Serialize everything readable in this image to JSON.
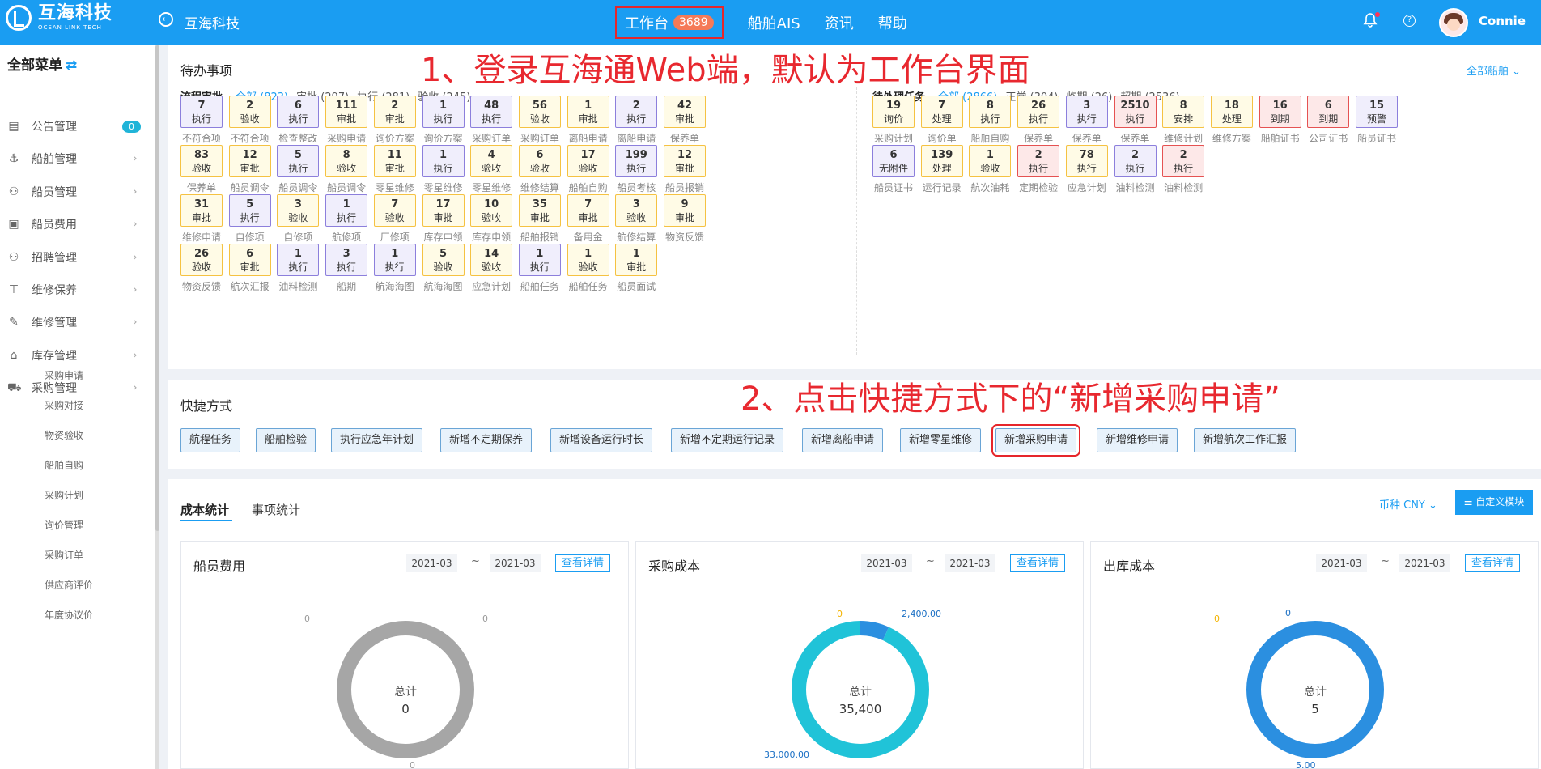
{
  "header": {
    "logo_cn": "互海科技",
    "logo_en": "OCEAN LINK TECH",
    "company": "互海科技",
    "workbench": "工作台",
    "workbench_badge": "3689",
    "nav": [
      "船舶AIS",
      "资讯",
      "帮助"
    ],
    "username": "Connie",
    "help_glyph": "?"
  },
  "sidebar": {
    "title": "全部菜单",
    "items": [
      {
        "label": "公告管理",
        "icon": "book-icon",
        "glyph": "▤",
        "badge": "0"
      },
      {
        "label": "船舶管理",
        "icon": "anchor-icon",
        "glyph": "⚓"
      },
      {
        "label": "船员管理",
        "icon": "user-icon",
        "glyph": "⚇"
      },
      {
        "label": "船员费用",
        "icon": "wallet-icon",
        "glyph": "▣"
      },
      {
        "label": "招聘管理",
        "icon": "recruit-icon",
        "glyph": "⚇"
      },
      {
        "label": "维修保养",
        "icon": "hammer-icon",
        "glyph": "⊤"
      },
      {
        "label": "维修管理",
        "icon": "wrench-icon",
        "glyph": "✎"
      },
      {
        "label": "库存管理",
        "icon": "warehouse-icon",
        "glyph": "⌂"
      },
      {
        "label": "采购管理",
        "icon": "cart-icon",
        "glyph": "⛟"
      }
    ],
    "sub": [
      "采购申请",
      "采购对接",
      "物资验收",
      "船舶自购",
      "采购计划",
      "询价管理",
      "采购订单",
      "供应商评价",
      "年度协议价"
    ]
  },
  "todo": {
    "title": "待办事项",
    "fleet": "全部船舶",
    "annotation1": "1、登录互海通Web端，默认为工作台界面",
    "approval": {
      "title": "流程审批",
      "filters": [
        "全部 (823)",
        "审批 (297)",
        "执行 (281)",
        "验收 (245)"
      ],
      "tiles": [
        [
          "7",
          "执行",
          "不符合项",
          "p"
        ],
        [
          "2",
          "验收",
          "不符合项",
          "y"
        ],
        [
          "6",
          "执行",
          "检查整改",
          "p"
        ],
        [
          "111",
          "审批",
          "采购申请",
          "y"
        ],
        [
          "2",
          "审批",
          "询价方案",
          "y"
        ],
        [
          "1",
          "执行",
          "询价方案",
          "p"
        ],
        [
          "48",
          "执行",
          "采购订单",
          "p"
        ],
        [
          "56",
          "验收",
          "采购订单",
          "y"
        ],
        [
          "1",
          "审批",
          "离船申请",
          "y"
        ],
        [
          "2",
          "执行",
          "离船申请",
          "p"
        ],
        [
          "42",
          "审批",
          "保养单",
          "y"
        ],
        [
          "83",
          "验收",
          "保养单",
          "y"
        ],
        [
          "12",
          "审批",
          "船员调令",
          "y"
        ],
        [
          "5",
          "执行",
          "船员调令",
          "p"
        ],
        [
          "8",
          "验收",
          "船员调令",
          "y"
        ],
        [
          "11",
          "审批",
          "零星维修",
          "y"
        ],
        [
          "1",
          "执行",
          "零星维修",
          "p"
        ],
        [
          "4",
          "验收",
          "零星维修",
          "y"
        ],
        [
          "6",
          "验收",
          "维修结算",
          "y"
        ],
        [
          "17",
          "验收",
          "船舶自购",
          "y"
        ],
        [
          "199",
          "执行",
          "船员考核",
          "p"
        ],
        [
          "12",
          "审批",
          "船员报销",
          "y"
        ],
        [
          "31",
          "审批",
          "维修申请",
          "y"
        ],
        [
          "5",
          "执行",
          "自修项",
          "p"
        ],
        [
          "3",
          "验收",
          "自修项",
          "y"
        ],
        [
          "1",
          "执行",
          "航修项",
          "p"
        ],
        [
          "7",
          "验收",
          "厂修项",
          "y"
        ],
        [
          "17",
          "审批",
          "库存申领",
          "y"
        ],
        [
          "10",
          "验收",
          "库存申领",
          "y"
        ],
        [
          "35",
          "审批",
          "船舶报销",
          "y"
        ],
        [
          "7",
          "审批",
          "备用金",
          "y"
        ],
        [
          "3",
          "验收",
          "航修结算",
          "y"
        ],
        [
          "9",
          "审批",
          "物资反馈",
          "y"
        ],
        [
          "26",
          "验收",
          "物资反馈",
          "y"
        ],
        [
          "6",
          "审批",
          "航次汇报",
          "y"
        ],
        [
          "1",
          "执行",
          "油料检测",
          "p"
        ],
        [
          "3",
          "执行",
          "船期",
          "p"
        ],
        [
          "1",
          "执行",
          "航海海图",
          "p"
        ],
        [
          "5",
          "验收",
          "航海海图",
          "y"
        ],
        [
          "14",
          "验收",
          "应急计划",
          "y"
        ],
        [
          "1",
          "执行",
          "船舶任务",
          "p"
        ],
        [
          "1",
          "验收",
          "船舶任务",
          "y"
        ],
        [
          "1",
          "审批",
          "船员面试",
          "y"
        ]
      ]
    },
    "tasks": {
      "title": "待处理任务",
      "filters": [
        "全部 (2866)",
        "正常 (304)",
        "临期 (26)",
        "超期 (2536)"
      ],
      "tiles": [
        [
          "19",
          "询价",
          "采购计划",
          "y"
        ],
        [
          "7",
          "处理",
          "询价单",
          "y"
        ],
        [
          "8",
          "执行",
          "船舶自购",
          "y"
        ],
        [
          "26",
          "执行",
          "保养单",
          "y"
        ],
        [
          "3",
          "执行",
          "保养单",
          "p"
        ],
        [
          "2510",
          "执行",
          "保养单",
          "r"
        ],
        [
          "8",
          "安排",
          "维修计划",
          "y"
        ],
        [
          "18",
          "处理",
          "维修方案",
          "y"
        ],
        [
          "16",
          "到期",
          "船舶证书",
          "r"
        ],
        [
          "6",
          "到期",
          "公司证书",
          "r"
        ],
        [
          "15",
          "预警",
          "船员证书",
          "p"
        ],
        [
          "6",
          "无附件",
          "船员证书",
          "p"
        ],
        [
          "139",
          "处理",
          "运行记录",
          "y"
        ],
        [
          "1",
          "验收",
          "航次油耗",
          "y"
        ],
        [
          "2",
          "执行",
          "定期检验",
          "r"
        ],
        [
          "78",
          "执行",
          "应急计划",
          "y"
        ],
        [
          "2",
          "执行",
          "油料检测",
          "p"
        ],
        [
          "2",
          "执行",
          "油料检测",
          "r"
        ]
      ]
    }
  },
  "shortcuts": {
    "title": "快捷方式",
    "annotation2": "2、点击快捷方式下的“新增采购申请”",
    "items": [
      "航程任务",
      "船舶检验",
      "执行应急年计划",
      "新增不定期保养",
      "新增设备运行时长",
      "新增不定期运行记录",
      "新增离船申请",
      "新增零星维修",
      "新增采购申请",
      "新增维修申请",
      "新增航次工作汇报"
    ]
  },
  "stats": {
    "tabs": [
      "成本统计",
      "事项统计"
    ],
    "currency": "币种  CNY",
    "custom_btn": "自定义模块",
    "total_label": "总计",
    "date_sep": "~",
    "detail": "查看详情",
    "cards": [
      {
        "title": "船员费用",
        "from": "2021-03",
        "to": "2021-03",
        "total": "0",
        "color": "#a6a6a6",
        "labels": [
          "0",
          "0",
          "0"
        ],
        "segments": [
          1
        ]
      },
      {
        "title": "采购成本",
        "from": "2021-03",
        "to": "2021-03",
        "total": "35,400",
        "color": "#20c3d8",
        "labels": [
          "0",
          "2,400.00",
          "33,000.00"
        ],
        "segments": [
          0.068,
          0.932
        ]
      },
      {
        "title": "出库成本",
        "from": "2021-03",
        "to": "2021-03",
        "total": "5",
        "color": "#2b8fe0",
        "labels": [
          "0",
          "0",
          "5.00"
        ],
        "segments": [
          1
        ]
      }
    ]
  }
}
